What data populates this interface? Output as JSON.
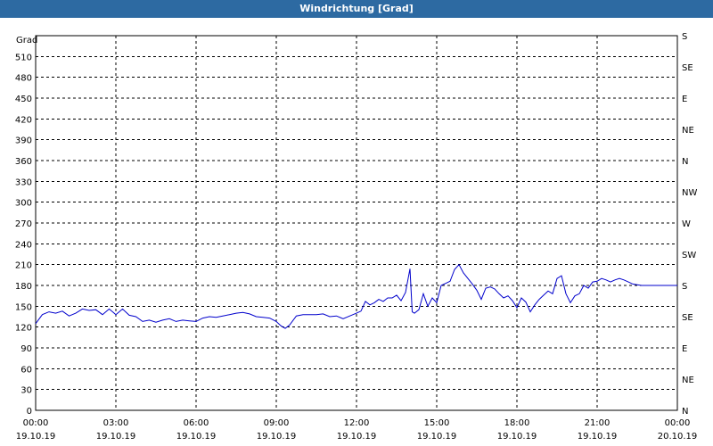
{
  "title": "Windrichtung [Grad]",
  "chart_data": {
    "type": "line",
    "title": "Windrichtung [Grad]",
    "ylabel": "Grad",
    "ylim": [
      0,
      540
    ],
    "xlim": [
      "2019-10-19T00:00",
      "2019-10-20T00:00"
    ],
    "grid": true,
    "y_ticks": [
      0,
      30,
      60,
      90,
      120,
      150,
      180,
      210,
      240,
      270,
      300,
      330,
      360,
      390,
      420,
      450,
      480,
      510
    ],
    "x_ticks": [
      {
        "time": "00:00",
        "date": "19.10.19"
      },
      {
        "time": "03:00",
        "date": "19.10.19"
      },
      {
        "time": "06:00",
        "date": "19.10.19"
      },
      {
        "time": "09:00",
        "date": "19.10.19"
      },
      {
        "time": "12:00",
        "date": "19.10.19"
      },
      {
        "time": "15:00",
        "date": "19.10.19"
      },
      {
        "time": "18:00",
        "date": "19.10.19"
      },
      {
        "time": "21:00",
        "date": "19.10.19"
      },
      {
        "time": "00:00",
        "date": "20.10.19"
      }
    ],
    "right_axis": {
      "labels": [
        "N",
        "NE",
        "E",
        "SE",
        "S",
        "SW",
        "W",
        "NW",
        "N",
        "NE",
        "E",
        "SE",
        "S"
      ],
      "values": [
        0,
        45,
        90,
        135,
        180,
        225,
        270,
        315,
        360,
        405,
        450,
        495,
        540
      ]
    },
    "series": [
      {
        "color": "#0000cc",
        "x": [
          "00:00",
          "00:15",
          "00:30",
          "00:45",
          "01:00",
          "01:15",
          "01:30",
          "01:45",
          "02:00",
          "02:15",
          "02:30",
          "02:45",
          "03:00",
          "03:15",
          "03:30",
          "03:45",
          "04:00",
          "04:15",
          "04:30",
          "04:45",
          "05:00",
          "05:15",
          "05:30",
          "05:45",
          "06:00",
          "06:15",
          "06:30",
          "06:45",
          "07:00",
          "07:15",
          "07:30",
          "07:45",
          "08:00",
          "08:15",
          "08:30",
          "08:45",
          "09:00",
          "09:10",
          "09:20",
          "09:30",
          "09:45",
          "10:00",
          "10:15",
          "10:30",
          "10:45",
          "11:00",
          "11:15",
          "11:30",
          "11:45",
          "12:00",
          "12:10",
          "12:20",
          "12:30",
          "12:40",
          "12:50",
          "13:00",
          "13:10",
          "13:20",
          "13:30",
          "13:40",
          "13:50",
          "14:00",
          "14:05",
          "14:10",
          "14:20",
          "14:30",
          "14:40",
          "14:50",
          "15:00",
          "15:10",
          "15:20",
          "15:30",
          "15:40",
          "15:50",
          "16:00",
          "16:10",
          "16:20",
          "16:30",
          "16:40",
          "16:50",
          "17:00",
          "17:10",
          "17:20",
          "17:30",
          "17:40",
          "17:50",
          "18:00",
          "18:10",
          "18:20",
          "18:30",
          "18:40",
          "18:50",
          "19:00",
          "19:10",
          "19:20",
          "19:30",
          "19:40",
          "19:50",
          "20:00",
          "20:10",
          "20:20",
          "20:30",
          "20:40",
          "20:50",
          "21:00",
          "21:10",
          "21:20",
          "21:30",
          "21:40",
          "21:50",
          "22:00",
          "22:10",
          "22:20",
          "22:30",
          "22:40",
          "22:50",
          "23:00",
          "23:10",
          "23:20",
          "23:30",
          "23:40",
          "23:50",
          "24:00"
        ],
        "values": [
          125,
          138,
          142,
          140,
          143,
          136,
          140,
          146,
          144,
          145,
          138,
          146,
          138,
          146,
          137,
          135,
          128,
          130,
          127,
          130,
          132,
          128,
          130,
          129,
          128,
          133,
          135,
          134,
          136,
          138,
          140,
          141,
          139,
          135,
          134,
          133,
          128,
          122,
          118,
          123,
          136,
          138,
          138,
          138,
          139,
          135,
          136,
          132,
          136,
          140,
          143,
          157,
          152,
          155,
          160,
          157,
          162,
          162,
          166,
          158,
          170,
          204,
          142,
          140,
          145,
          168,
          150,
          162,
          155,
          180,
          183,
          186,
          203,
          210,
          198,
          190,
          182,
          173,
          160,
          176,
          178,
          175,
          168,
          162,
          165,
          158,
          148,
          162,
          156,
          142,
          152,
          160,
          166,
          172,
          168,
          190,
          194,
          168,
          155,
          165,
          168,
          180,
          176,
          185,
          186,
          190,
          188,
          185,
          188,
          190,
          188,
          185,
          182,
          181,
          180,
          180,
          180,
          180,
          180,
          180,
          180,
          180,
          180
        ]
      }
    ]
  }
}
